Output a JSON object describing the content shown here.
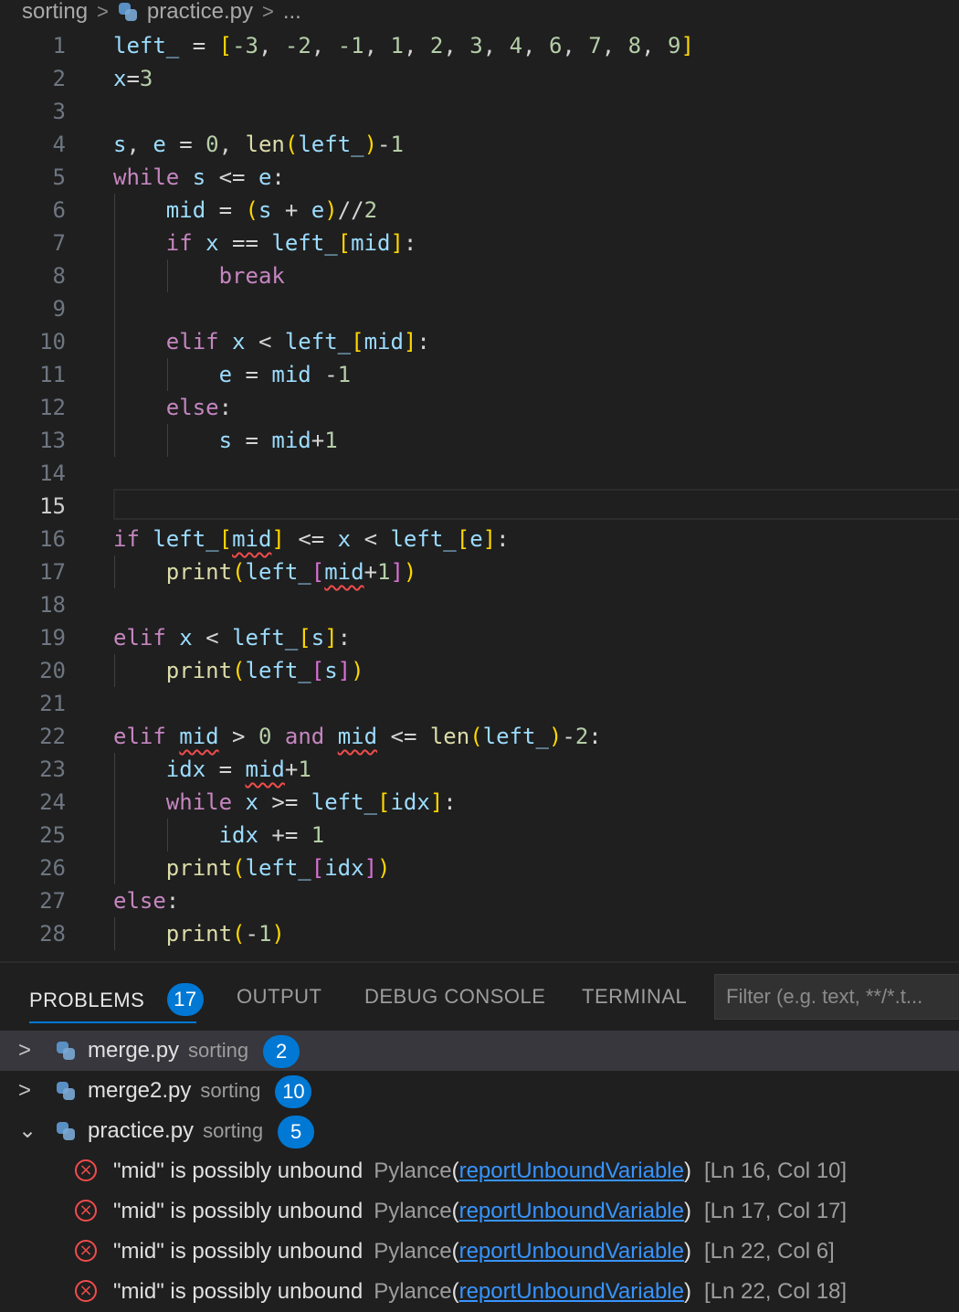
{
  "breadcrumb": {
    "folder": "sorting",
    "file": "practice.py",
    "more": "..."
  },
  "editor": {
    "active_line": 15,
    "lines": [
      [
        [
          "v",
          "left_"
        ],
        [
          "p",
          " = "
        ],
        [
          "b1",
          "["
        ],
        [
          "n",
          "-3"
        ],
        [
          "p",
          ", "
        ],
        [
          "n",
          "-2"
        ],
        [
          "p",
          ", "
        ],
        [
          "n",
          "-1"
        ],
        [
          "p",
          ", "
        ],
        [
          "n",
          "1"
        ],
        [
          "p",
          ", "
        ],
        [
          "n",
          "2"
        ],
        [
          "p",
          ", "
        ],
        [
          "n",
          "3"
        ],
        [
          "p",
          ", "
        ],
        [
          "n",
          "4"
        ],
        [
          "p",
          ", "
        ],
        [
          "n",
          "6"
        ],
        [
          "p",
          ", "
        ],
        [
          "n",
          "7"
        ],
        [
          "p",
          ", "
        ],
        [
          "n",
          "8"
        ],
        [
          "p",
          ", "
        ],
        [
          "n",
          "9"
        ],
        [
          "b1",
          "]"
        ]
      ],
      [
        [
          "v",
          "x"
        ],
        [
          "p",
          "="
        ],
        [
          "n",
          "3"
        ]
      ],
      [],
      [
        [
          "v",
          "s"
        ],
        [
          "p",
          ", "
        ],
        [
          "v",
          "e"
        ],
        [
          "p",
          " = "
        ],
        [
          "n",
          "0"
        ],
        [
          "p",
          ", "
        ],
        [
          "f",
          "len"
        ],
        [
          "b1",
          "("
        ],
        [
          "v",
          "left_"
        ],
        [
          "b1",
          ")"
        ],
        [
          "p",
          "-"
        ],
        [
          "n",
          "1"
        ]
      ],
      [
        [
          "kw",
          "while"
        ],
        [
          "p",
          " "
        ],
        [
          "v",
          "s"
        ],
        [
          "p",
          " <= "
        ],
        [
          "v",
          "e"
        ],
        [
          "p",
          ":"
        ]
      ],
      [
        [
          "p",
          "    "
        ],
        [
          "v",
          "mid"
        ],
        [
          "p",
          " = "
        ],
        [
          "b1",
          "("
        ],
        [
          "v",
          "s"
        ],
        [
          "p",
          " + "
        ],
        [
          "v",
          "e"
        ],
        [
          "b1",
          ")"
        ],
        [
          "p",
          "//"
        ],
        [
          "n",
          "2"
        ]
      ],
      [
        [
          "p",
          "    "
        ],
        [
          "kw",
          "if"
        ],
        [
          "p",
          " "
        ],
        [
          "v",
          "x"
        ],
        [
          "p",
          " == "
        ],
        [
          "v",
          "left_"
        ],
        [
          "b1",
          "["
        ],
        [
          "v",
          "mid"
        ],
        [
          "b1",
          "]"
        ],
        [
          "p",
          ":"
        ]
      ],
      [
        [
          "p",
          "        "
        ],
        [
          "kw",
          "break"
        ]
      ],
      [],
      [
        [
          "p",
          "    "
        ],
        [
          "kw",
          "elif"
        ],
        [
          "p",
          " "
        ],
        [
          "v",
          "x"
        ],
        [
          "p",
          " < "
        ],
        [
          "v",
          "left_"
        ],
        [
          "b1",
          "["
        ],
        [
          "v",
          "mid"
        ],
        [
          "b1",
          "]"
        ],
        [
          "p",
          ":"
        ]
      ],
      [
        [
          "p",
          "        "
        ],
        [
          "v",
          "e"
        ],
        [
          "p",
          " = "
        ],
        [
          "v",
          "mid"
        ],
        [
          "p",
          " -"
        ],
        [
          "n",
          "1"
        ]
      ],
      [
        [
          "p",
          "    "
        ],
        [
          "kw",
          "else"
        ],
        [
          "p",
          ":"
        ]
      ],
      [
        [
          "p",
          "        "
        ],
        [
          "v",
          "s"
        ],
        [
          "p",
          " = "
        ],
        [
          "v",
          "mid"
        ],
        [
          "p",
          "+"
        ],
        [
          "n",
          "1"
        ]
      ],
      [],
      [],
      [
        [
          "kw",
          "if"
        ],
        [
          "p",
          " "
        ],
        [
          "v",
          "left_"
        ],
        [
          "b1",
          "["
        ],
        [
          "v squig",
          "mid"
        ],
        [
          "b1",
          "]"
        ],
        [
          "p",
          " <= "
        ],
        [
          "v",
          "x"
        ],
        [
          "p",
          " < "
        ],
        [
          "v",
          "left_"
        ],
        [
          "b1",
          "["
        ],
        [
          "v",
          "e"
        ],
        [
          "b1",
          "]"
        ],
        [
          "p",
          ":"
        ]
      ],
      [
        [
          "p",
          "    "
        ],
        [
          "f",
          "print"
        ],
        [
          "b1",
          "("
        ],
        [
          "v",
          "left_"
        ],
        [
          "b2",
          "["
        ],
        [
          "v squig",
          "mid"
        ],
        [
          "p",
          "+"
        ],
        [
          "n",
          "1"
        ],
        [
          "b2",
          "]"
        ],
        [
          "b1",
          ")"
        ]
      ],
      [],
      [
        [
          "kw",
          "elif"
        ],
        [
          "p",
          " "
        ],
        [
          "v",
          "x"
        ],
        [
          "p",
          " < "
        ],
        [
          "v",
          "left_"
        ],
        [
          "b1",
          "["
        ],
        [
          "v",
          "s"
        ],
        [
          "b1",
          "]"
        ],
        [
          "p",
          ":"
        ]
      ],
      [
        [
          "p",
          "    "
        ],
        [
          "f",
          "print"
        ],
        [
          "b1",
          "("
        ],
        [
          "v",
          "left_"
        ],
        [
          "b2",
          "["
        ],
        [
          "v",
          "s"
        ],
        [
          "b2",
          "]"
        ],
        [
          "b1",
          ")"
        ]
      ],
      [],
      [
        [
          "kw",
          "elif"
        ],
        [
          "p",
          " "
        ],
        [
          "v squig",
          "mid"
        ],
        [
          "p",
          " > "
        ],
        [
          "n",
          "0"
        ],
        [
          "p",
          " "
        ],
        [
          "kw",
          "and"
        ],
        [
          "p",
          " "
        ],
        [
          "v squig",
          "mid"
        ],
        [
          "p",
          " <= "
        ],
        [
          "f",
          "len"
        ],
        [
          "b1",
          "("
        ],
        [
          "v",
          "left_"
        ],
        [
          "b1",
          ")"
        ],
        [
          "p",
          "-"
        ],
        [
          "n",
          "2"
        ],
        [
          "p",
          ":"
        ]
      ],
      [
        [
          "p",
          "    "
        ],
        [
          "v",
          "idx"
        ],
        [
          "p",
          " = "
        ],
        [
          "v squig",
          "mid"
        ],
        [
          "p",
          "+"
        ],
        [
          "n",
          "1"
        ]
      ],
      [
        [
          "p",
          "    "
        ],
        [
          "kw",
          "while"
        ],
        [
          "p",
          " "
        ],
        [
          "v",
          "x"
        ],
        [
          "p",
          " >= "
        ],
        [
          "v",
          "left_"
        ],
        [
          "b1",
          "["
        ],
        [
          "v",
          "idx"
        ],
        [
          "b1",
          "]"
        ],
        [
          "p",
          ":"
        ]
      ],
      [
        [
          "p",
          "        "
        ],
        [
          "v",
          "idx"
        ],
        [
          "p",
          " += "
        ],
        [
          "n",
          "1"
        ]
      ],
      [
        [
          "p",
          "    "
        ],
        [
          "f",
          "print"
        ],
        [
          "b1",
          "("
        ],
        [
          "v",
          "left_"
        ],
        [
          "b2",
          "["
        ],
        [
          "v",
          "idx"
        ],
        [
          "b2",
          "]"
        ],
        [
          "b1",
          ")"
        ]
      ],
      [
        [
          "kw",
          "else"
        ],
        [
          "p",
          ":"
        ]
      ],
      [
        [
          "p",
          "    "
        ],
        [
          "f",
          "print"
        ],
        [
          "b1",
          "("
        ],
        [
          "p",
          "-"
        ],
        [
          "n",
          "1"
        ],
        [
          "b1",
          ")"
        ]
      ]
    ]
  },
  "panel": {
    "tabs": [
      {
        "label": "PROBLEMS",
        "badge": "17"
      },
      {
        "label": "OUTPUT"
      },
      {
        "label": "DEBUG CONSOLE"
      },
      {
        "label": "TERMINAL"
      }
    ],
    "filter_placeholder": "Filter (e.g. text, **/*.t...",
    "groups": [
      {
        "file": "merge.py",
        "folder": "sorting",
        "count": "2",
        "expanded": false,
        "chevron": ">"
      },
      {
        "file": "merge2.py",
        "folder": "sorting",
        "count": "10",
        "expanded": false,
        "chevron": ">"
      },
      {
        "file": "practice.py",
        "folder": "sorting",
        "count": "5",
        "expanded": true,
        "chevron": "⌄"
      }
    ],
    "problems": [
      {
        "message": "\"mid\" is possibly unbound",
        "source": "Pylance",
        "code": "reportUnboundVariable",
        "location": "[Ln 16, Col 10]"
      },
      {
        "message": "\"mid\" is possibly unbound",
        "source": "Pylance",
        "code": "reportUnboundVariable",
        "location": "[Ln 17, Col 17]"
      },
      {
        "message": "\"mid\" is possibly unbound",
        "source": "Pylance",
        "code": "reportUnboundVariable",
        "location": "[Ln 22, Col 6]"
      },
      {
        "message": "\"mid\" is possibly unbound",
        "source": "Pylance",
        "code": "reportUnboundVariable",
        "location": "[Ln 22, Col 18]"
      }
    ]
  },
  "colors": {
    "accent": "#0078d4",
    "error": "#f14c4c",
    "keyword": "#c586c0",
    "variable": "#9cdcfe",
    "number": "#b5cea8",
    "function": "#dcdcaa"
  }
}
